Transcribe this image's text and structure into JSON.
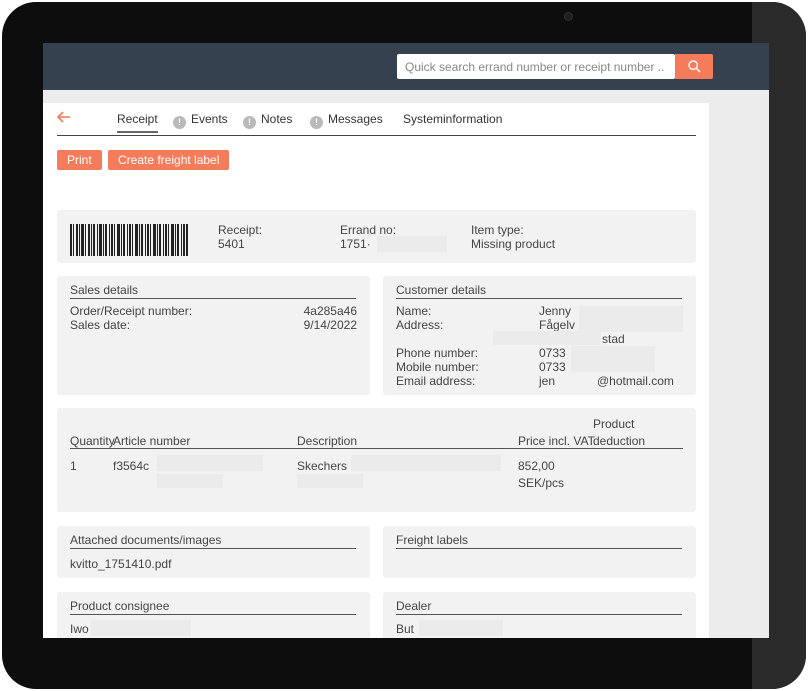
{
  "search": {
    "placeholder": "Quick search errand number or receipt number .."
  },
  "tabs": [
    {
      "label": "Receipt"
    },
    {
      "label": "Events"
    },
    {
      "label": "Notes"
    },
    {
      "label": "Messages"
    },
    {
      "label": "Systeminformation"
    }
  ],
  "actions": {
    "print": "Print",
    "create_freight_label": "Create freight label"
  },
  "summary": {
    "receipt_label": "Receipt:",
    "receipt_value": "5401",
    "errand_label": "Errand no:",
    "errand_value": "1751·",
    "item_type_label": "Item type:",
    "item_type_value": "Missing product"
  },
  "sales": {
    "title": "Sales details",
    "order_label": "Order/Receipt number:",
    "order_value": "4a285a46",
    "date_label": "Sales date:",
    "date_value": "9/14/2022"
  },
  "customer": {
    "title": "Customer details",
    "name_label": "Name:",
    "name_value": "Jenny",
    "address_label": "Address:",
    "address_value": "Fågelv",
    "address_city": "stad",
    "phone_label": "Phone number:",
    "phone_value": "0733",
    "mobile_label": "Mobile number:",
    "mobile_value": "0733",
    "email_label": "Email address:",
    "email_user": "jen",
    "email_domain": "@hotmail.com"
  },
  "items": {
    "headers": {
      "quantity": "Quantity",
      "article": "Article number",
      "description": "Description",
      "price": "Price incl. VAT",
      "deduction_line1": "Product",
      "deduction_line2": "deduction"
    },
    "rows": [
      {
        "quantity": "1",
        "article": "f3564c",
        "description": "Skechers I",
        "price_line1": "852,00",
        "price_line2": "SEK/pcs"
      }
    ]
  },
  "attachments": {
    "title": "Attached documents/images",
    "file": "kvitto_1751410.pdf"
  },
  "freight": {
    "title": "Freight labels"
  },
  "consignee": {
    "title": "Product consignee",
    "line1": "Iwo"
  },
  "dealer": {
    "title": "Dealer",
    "line1": "But"
  },
  "colors": {
    "accent": "#f57c5b",
    "topbar": "#36414f",
    "card": "#f2f2f2"
  }
}
